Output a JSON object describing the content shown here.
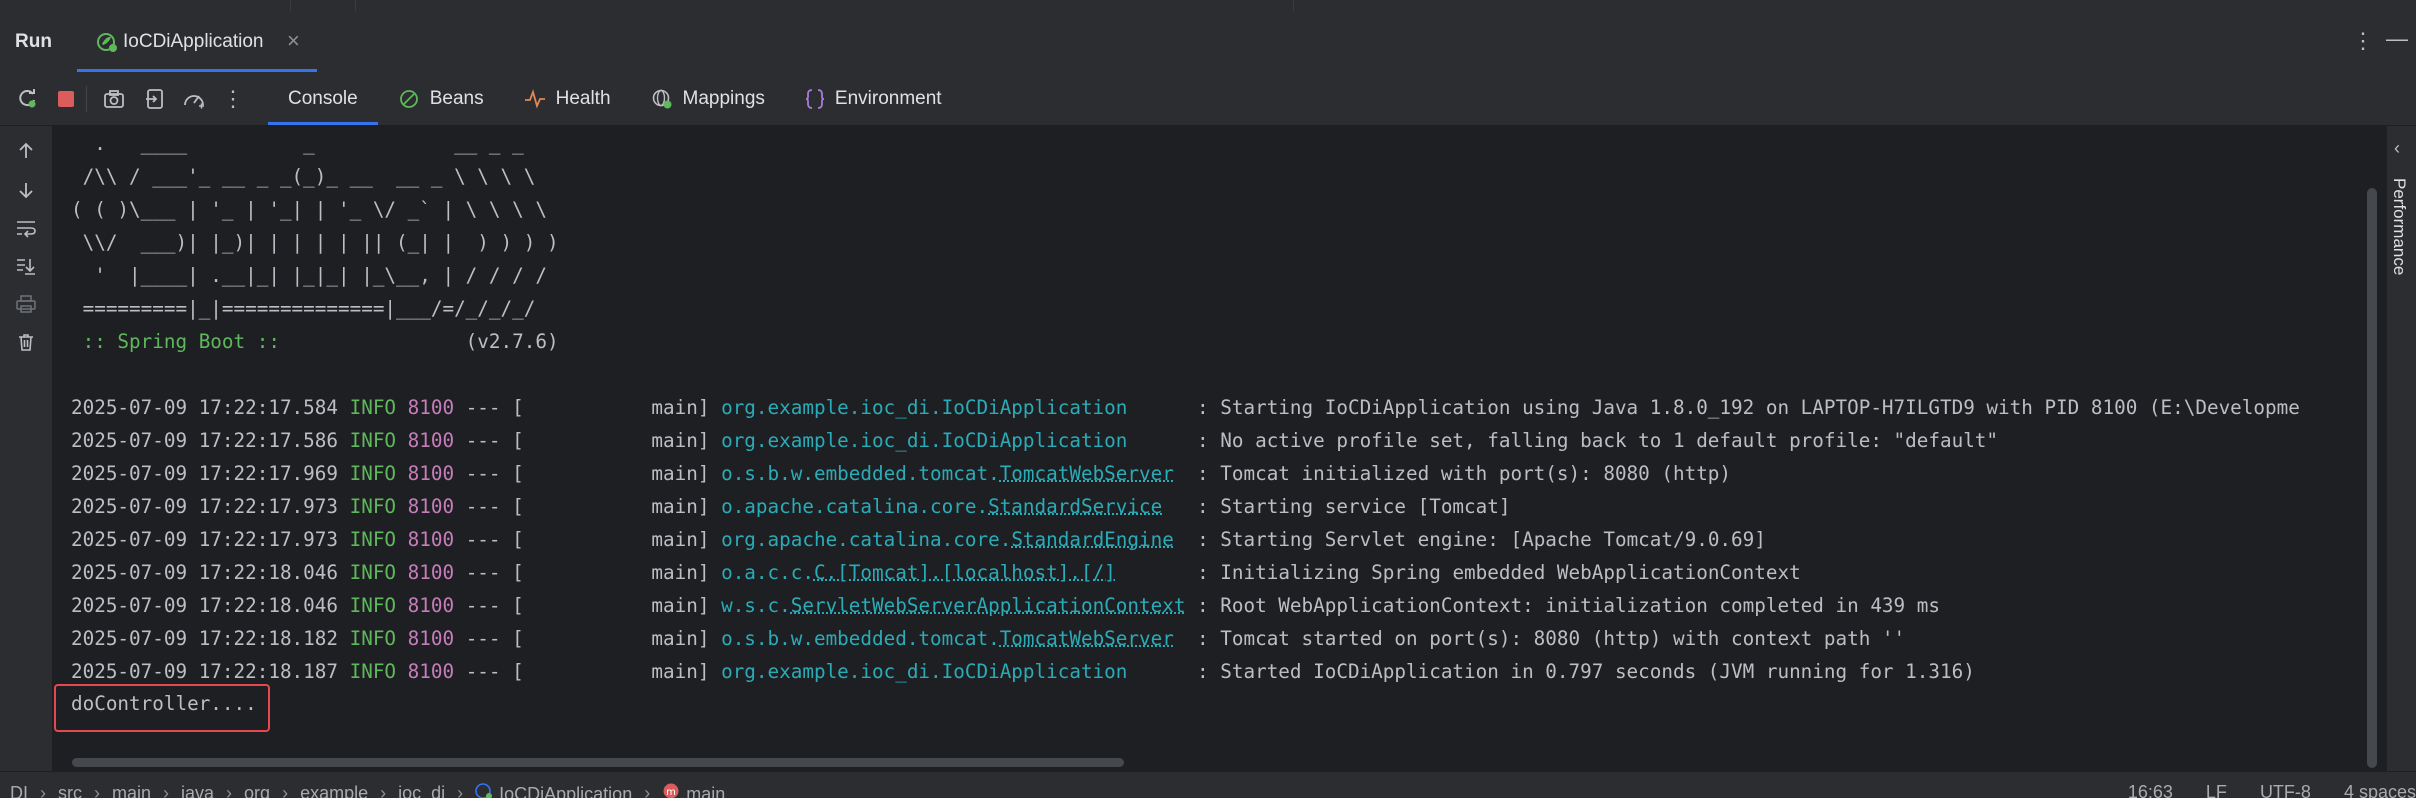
{
  "run_panel": {
    "label": "Run",
    "tab_title": "IoCDiApplication",
    "tab_close": "×",
    "more_icon": "⋮",
    "minimize_icon": "—"
  },
  "toolbar": {
    "more_icon": "⋮",
    "tabs": [
      {
        "label": "Console",
        "icon": "console",
        "active": true
      },
      {
        "label": "Beans",
        "icon": "beans-icon"
      },
      {
        "label": "Health",
        "icon": "health-icon"
      },
      {
        "label": "Mappings",
        "icon": "mappings-icon"
      },
      {
        "label": "Environment",
        "icon": "environment-icon"
      }
    ]
  },
  "console": {
    "banner": [
      "  .   ____          _            __ _ _",
      " /\\\\ / ___'_ __ _ _(_)_ __  __ _ \\ \\ \\ \\",
      "( ( )\\___ | '_ | '_| | '_ \\/ _` | \\ \\ \\ \\",
      " \\\\/  ___)| |_)| | | | | || (_| |  ) ) ) )",
      "  '  |____| .__|_| |_|_| |_\\__, | / / / /",
      " =========|_|==============|___/=/_/_/_/"
    ],
    "spring_label": " :: Spring Boot :: ",
    "spring_version": "               (v2.7.6)",
    "logs": [
      {
        "ts": "2025-07-09 17:22:17.584",
        "level": "INFO",
        "pid": "8100",
        "sep": " --- [           main] ",
        "logger_pre": "org.example.ioc_di.IoCDiApplication",
        "logger_cls": "",
        "pad": "      ",
        "msg": ": Starting IoCDiApplication using Java 1.8.0_192 on LAPTOP-H7ILGTD9 with PID 8100 (E:\\Developme"
      },
      {
        "ts": "2025-07-09 17:22:17.586",
        "level": "INFO",
        "pid": "8100",
        "sep": " --- [           main] ",
        "logger_pre": "org.example.ioc_di.IoCDiApplication",
        "logger_cls": "",
        "pad": "      ",
        "msg": ": No active profile set, falling back to 1 default profile: \"default\""
      },
      {
        "ts": "2025-07-09 17:22:17.969",
        "level": "INFO",
        "pid": "8100",
        "sep": " --- [           main] ",
        "logger_pre": "o.s.b.w.embedded.tomcat.",
        "logger_cls": "TomcatWebServer",
        "pad": "  ",
        "msg": ": Tomcat initialized with port(s): 8080 (http)"
      },
      {
        "ts": "2025-07-09 17:22:17.973",
        "level": "INFO",
        "pid": "8100",
        "sep": " --- [           main] ",
        "logger_pre": "o.apache.catalina.core.",
        "logger_cls": "StandardService",
        "pad": "   ",
        "msg": ": Starting service [Tomcat]"
      },
      {
        "ts": "2025-07-09 17:22:17.973",
        "level": "INFO",
        "pid": "8100",
        "sep": " --- [           main] ",
        "logger_pre": "org.apache.catalina.core.",
        "logger_cls": "StandardEngine",
        "pad": "  ",
        "msg": ": Starting Servlet engine: [Apache Tomcat/9.0.69]"
      },
      {
        "ts": "2025-07-09 17:22:18.046",
        "level": "INFO",
        "pid": "8100",
        "sep": " --- [           main] ",
        "logger_pre": "o.a.c.c.",
        "logger_cls": "C.[Tomcat].[localhost].[/]",
        "pad": "       ",
        "msg": ": Initializing Spring embedded WebApplicationContext"
      },
      {
        "ts": "2025-07-09 17:22:18.046",
        "level": "INFO",
        "pid": "8100",
        "sep": " --- [           main] ",
        "logger_pre": "w.s.c.",
        "logger_cls": "ServletWebServerApplicationContext",
        "pad": " ",
        "msg": ": Root WebApplicationContext: initialization completed in 439 ms"
      },
      {
        "ts": "2025-07-09 17:22:18.182",
        "level": "INFO",
        "pid": "8100",
        "sep": " --- [           main] ",
        "logger_pre": "o.s.b.w.embedded.tomcat.",
        "logger_cls": "TomcatWebServer",
        "pad": "  ",
        "msg": ": Tomcat started on port(s): 8080 (http) with context path ''"
      },
      {
        "ts": "2025-07-09 17:22:18.187",
        "level": "INFO",
        "pid": "8100",
        "sep": " --- [           main] ",
        "logger_pre": "org.example.ioc_di.IoCDiApplication",
        "logger_cls": "",
        "pad": "      ",
        "msg": ": Started IoCDiApplication in 0.797 seconds (JVM running for 1.316)"
      }
    ],
    "output": "doController...."
  },
  "right_sidebar": {
    "arrow": "‹",
    "label": "Performance"
  },
  "statusbar": {
    "crumbs": [
      {
        "label": "DI"
      },
      {
        "label": "src"
      },
      {
        "label": "main"
      },
      {
        "label": "java"
      },
      {
        "label": "org"
      },
      {
        "label": "example"
      },
      {
        "label": "ioc_di"
      },
      {
        "label": "IoCDiApplication",
        "icon": "class-icon"
      },
      {
        "label": "main",
        "icon": "method-icon"
      }
    ],
    "separator": "›",
    "position": "16:63",
    "line_ending": "LF",
    "encoding": "UTF-8",
    "indent": "4 spaces"
  },
  "colors": {
    "accent": "#3574f0",
    "info": "#5fb85c",
    "pid": "#c77dbb",
    "logger": "#2aacb8",
    "highlight_border": "#e5484d"
  }
}
